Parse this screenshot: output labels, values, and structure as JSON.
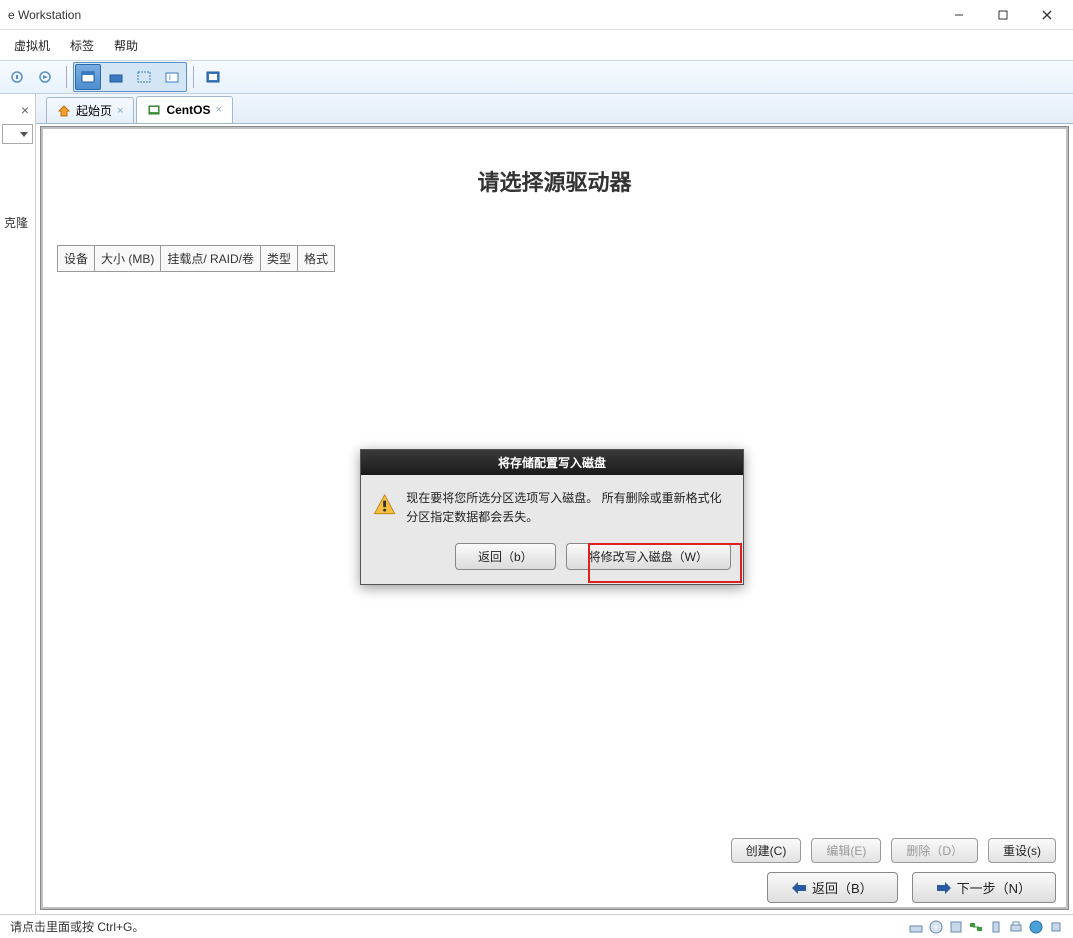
{
  "titlebar": {
    "title": "e Workstation"
  },
  "menubar": {
    "items": [
      "虚拟机",
      "标签",
      "帮助"
    ]
  },
  "sidebar": {
    "truncated_text": "克隆"
  },
  "tabs": [
    {
      "label": "起始页",
      "active": false
    },
    {
      "label": "CentOS",
      "active": true
    }
  ],
  "installer": {
    "heading": "请选择源驱动器",
    "columns": [
      "设备",
      "大小 (MB)",
      "挂载点/ RAID/卷",
      "类型",
      "格式"
    ],
    "actions": {
      "create": "创建(C)",
      "edit": "编辑(E)",
      "delete": "删除（D）",
      "reset": "重设(s)"
    },
    "nav": {
      "back": "返回（B）",
      "next": "下一步（N）"
    }
  },
  "dialog": {
    "title": "将存储配置写入磁盘",
    "message": "现在要将您所选分区选项写入磁盘。 所有删除或重新格式化分区指定数据都会丢失。",
    "back_btn": "返回（b）",
    "write_btn": "将修改写入磁盘（W）"
  },
  "statusbar": {
    "hint": "请点击里面或按 Ctrl+G。"
  }
}
